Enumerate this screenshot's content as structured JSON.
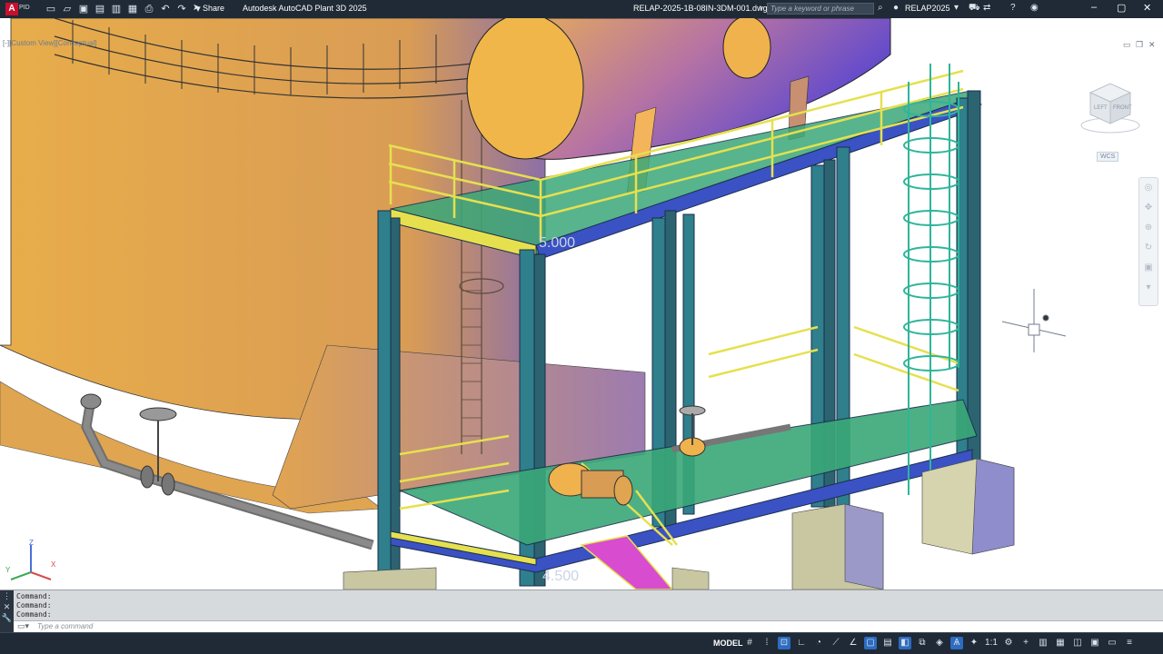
{
  "app": {
    "logo_letter": "A",
    "logo_sub": "PID",
    "title": "Autodesk AutoCAD Plant 3D 2025",
    "document": "RELAP-2025-1B-08IN-3DM-001.dwg",
    "share_label": "Share",
    "search_placeholder": "Type a keyword or phrase",
    "user": "RELAP2025"
  },
  "viewport": {
    "label": "[-][Custom View][Conceptual]",
    "wcs_label": "WCS",
    "elevation_label_1": "5.000",
    "elevation_label_2": "4.500",
    "viewcube_left": "LEFT",
    "viewcube_front": "FRONT",
    "ucs_x": "X",
    "ucs_y": "Y",
    "ucs_z": "Z"
  },
  "command": {
    "history": [
      "Command:",
      "Command:",
      "Command:"
    ],
    "placeholder": "Type a command"
  },
  "status": {
    "model_label": "MODEL",
    "scale_label": "1:1"
  },
  "colors": {
    "tank": "#e9b04c",
    "steel": "#2f7f8c",
    "beam_top": "#3b52c4",
    "grating": "#3aa878",
    "handrail": "#e6e04f",
    "foundation": "#c8c7a1"
  }
}
